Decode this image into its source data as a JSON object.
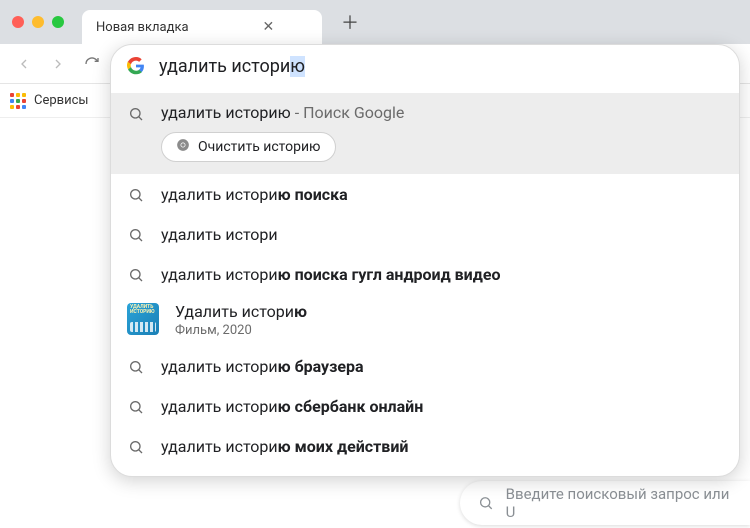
{
  "tab": {
    "title": "Новая вкладка"
  },
  "bookmarks": {
    "apps_label": "Сервисы"
  },
  "omnibox": {
    "query_prefix": "удалить истори",
    "query_selected": "ю"
  },
  "suggestions": [
    {
      "kind": "search-chip",
      "text": "удалить историю",
      "suffix": " - Поиск Google",
      "chip_label": "Очистить историю"
    },
    {
      "kind": "search",
      "text": "удалить истори",
      "bold": "ю поиска"
    },
    {
      "kind": "search",
      "text": "удалить истори",
      "bold": ""
    },
    {
      "kind": "search",
      "text": "удалить истори",
      "bold": "ю поиска гугл андроид видео"
    },
    {
      "kind": "entity",
      "title": "Удалить истори",
      "title_bold": "ю",
      "subtitle": "Фильм, 2020"
    },
    {
      "kind": "search",
      "text": "удалить истори",
      "bold": "ю браузера"
    },
    {
      "kind": "search",
      "text": "удалить истори",
      "bold": "ю сбербанк онлайн"
    },
    {
      "kind": "search",
      "text": "удалить истори",
      "bold": "ю моих действий"
    }
  ],
  "bottom_search": {
    "placeholder": "Введите поисковый запрос или U"
  }
}
